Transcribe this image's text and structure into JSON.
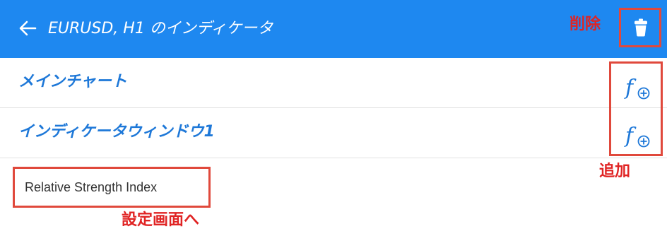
{
  "header": {
    "title": "EURUSD, H1 のインディケータ",
    "background_color": "#1e88f0",
    "back_icon": "arrow-left-icon",
    "delete_icon": "trash-icon"
  },
  "windows": [
    {
      "label": "メインチャート",
      "add_icon": "function-add-icon"
    },
    {
      "label": "インディケータウィンドウ1",
      "add_icon": "function-add-icon"
    }
  ],
  "indicators": [
    {
      "name": "Relative Strength Index"
    }
  ],
  "annotations": {
    "delete": "削除",
    "add": "追加",
    "settings": "設定画面へ",
    "color": "#e02424"
  },
  "link_color": "#1e78d8"
}
